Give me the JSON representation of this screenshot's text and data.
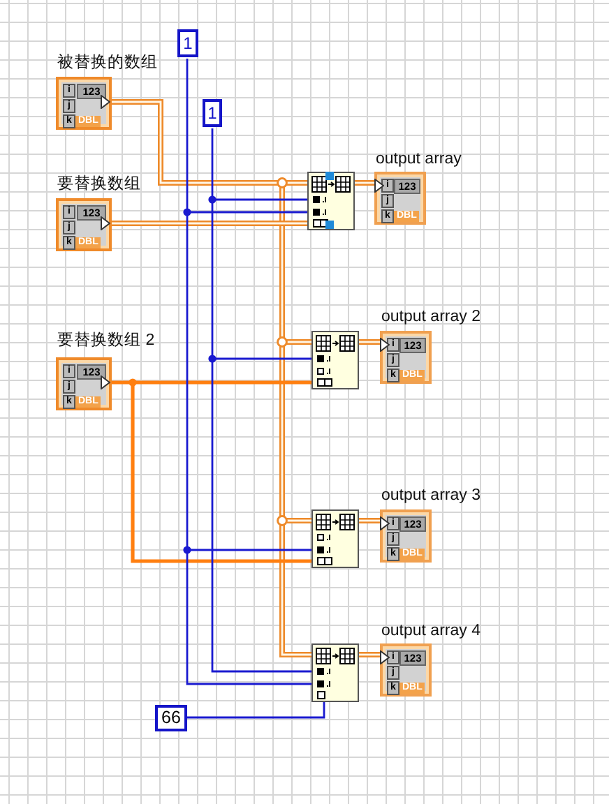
{
  "constants": [
    {
      "value": "1"
    },
    {
      "value": "1"
    },
    {
      "value": "66"
    }
  ],
  "controls": [
    {
      "label": "被替换的数组",
      "index_labels": [
        "i",
        "j",
        "k"
      ],
      "value": "123",
      "type": "DBL"
    },
    {
      "label": "要替换数组",
      "index_labels": [
        "i",
        "j",
        "k"
      ],
      "value": "123",
      "type": "DBL"
    },
    {
      "label": "要替换数组 2",
      "index_labels": [
        "i",
        "j",
        "k"
      ],
      "value": "123",
      "type": "DBL"
    }
  ],
  "nodes": [
    {
      "kind": "subarray",
      "highlighted": true,
      "index_wired": [
        true,
        true
      ]
    },
    {
      "kind": "subarray",
      "highlighted": false,
      "index_wired": [
        true,
        false
      ]
    },
    {
      "kind": "subarray",
      "highlighted": false,
      "index_wired": [
        false,
        true
      ]
    },
    {
      "kind": "element",
      "highlighted": false,
      "index_wired": [
        true,
        true
      ]
    }
  ],
  "indicators": [
    {
      "label": "output array",
      "index_labels": [
        "i",
        "j",
        "k"
      ],
      "value": "123",
      "type": "DBL"
    },
    {
      "label": "output array 2",
      "index_labels": [
        "i",
        "j",
        "k"
      ],
      "value": "123",
      "type": "DBL"
    },
    {
      "label": "output array 3",
      "index_labels": [
        "i",
        "j",
        "k"
      ],
      "value": "123",
      "type": "DBL"
    },
    {
      "label": "output array 4",
      "index_labels": [
        "i",
        "j",
        "k"
      ],
      "value": "123",
      "type": "DBL"
    }
  ]
}
